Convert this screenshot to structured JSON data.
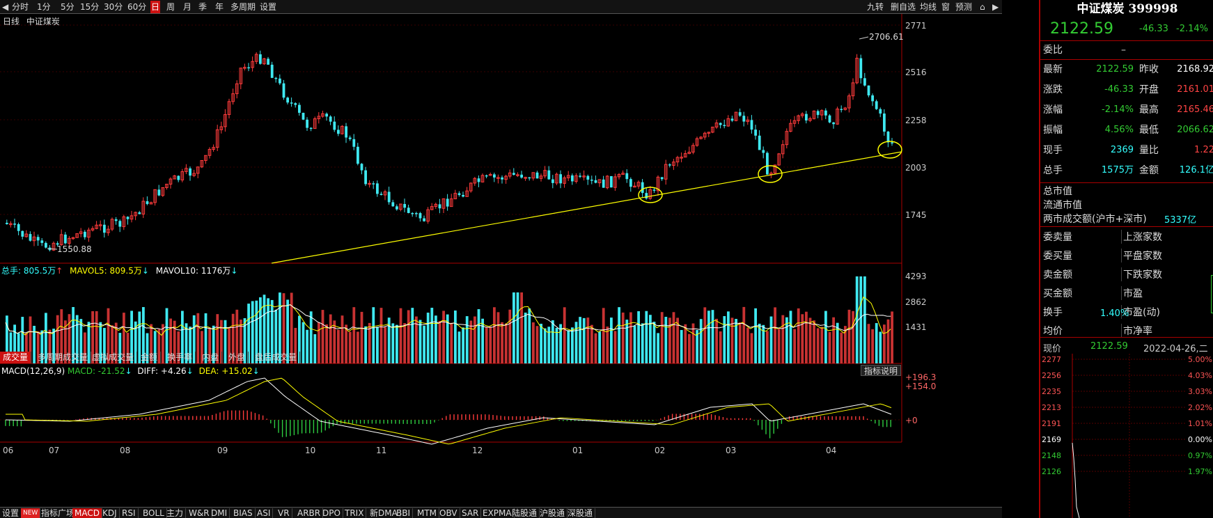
{
  "toolbar": {
    "items": [
      "分时",
      "1分",
      "5分",
      "15分",
      "30分",
      "60分",
      "日",
      "周",
      "月",
      "季",
      "年",
      "多周期",
      "设置"
    ],
    "active": "日",
    "right": [
      "九转",
      "删自选",
      "均线",
      "窗",
      "预测"
    ]
  },
  "chart": {
    "period_label": "日线",
    "name": "中证煤炭",
    "price_axis": [
      "2771",
      "2516",
      "2258",
      "2003",
      "1745"
    ],
    "high_label": "2706.61",
    "low_label": "1550.88"
  },
  "volume": {
    "total_label": "总手: 805.5万",
    "mavol5_label": "MAVOL5: 809.5万",
    "mavol10_label": "MAVOL10: 1176万",
    "axis": [
      "4293",
      "2862",
      "1431"
    ]
  },
  "volume_tabs": [
    "成交量",
    "多周期成交量",
    "虚拟成交量",
    "金额",
    "换手率",
    "内盘",
    "外盘",
    "盘后成交量"
  ],
  "macd": {
    "title": "MACD(12,26,9)",
    "macd_label": "MACD: -21.52",
    "diff_label": "DIFF: +4.26",
    "dea_label": "DEA: +15.02",
    "axis": [
      "+196.3",
      "+154.0",
      "+0"
    ],
    "explain": "指标说明"
  },
  "months": [
    "06",
    "07",
    "08",
    "09",
    "10",
    "11",
    "12",
    "01",
    "02",
    "03",
    "04"
  ],
  "bottom_tabs": [
    "设置",
    "NEW",
    "指标广场",
    "MACD",
    "KDJ",
    "RSI",
    "BOLL",
    "主力",
    "W&R",
    "DMI",
    "BIAS",
    "ASI",
    "VR",
    "ARBR",
    "DPO",
    "TRIX",
    "新DMA",
    "BBI",
    "MTM",
    "OBV",
    "SAR",
    "EXPMA",
    "陆股通",
    "沪股通",
    "深股通"
  ],
  "quote": {
    "title": "中证煤炭 399998",
    "price": "2122.59",
    "change": "-46.33",
    "pct": "-2.14%",
    "weibi": "委比",
    "weibi_v": "–",
    "rows": [
      [
        "最新",
        "2122.59",
        "昨收",
        "2168.92"
      ],
      [
        "涨跌",
        "-46.33",
        "开盘",
        "2161.01"
      ],
      [
        "涨幅",
        "-2.14%",
        "最高",
        "2165.46"
      ],
      [
        "振幅",
        "4.56%",
        "最低",
        "2066.62"
      ],
      [
        "现手",
        "2369",
        "量比",
        "1.22"
      ],
      [
        "总手",
        "1575万",
        "金额",
        "126.1亿"
      ]
    ],
    "rows2": [
      "总市值",
      "流通市值",
      "两市成交额(沪市+深市)"
    ],
    "turnover_total": "5337亿",
    "rows3": [
      [
        "委卖量",
        "上涨家数"
      ],
      [
        "委买量",
        "平盘家数"
      ],
      [
        "卖金额",
        "下跌家数"
      ],
      [
        "买金额",
        "市盈"
      ],
      [
        "换手",
        "市盈(动)"
      ],
      [
        "均价",
        "市净率"
      ]
    ],
    "turnover_rate": "1.40%",
    "intraday_label": "现价",
    "intraday_price": "2122.59",
    "date": "2022-04-26,二",
    "mini_axis": [
      "2277",
      "2256",
      "2235",
      "2213",
      "2191",
      "2169",
      "2148",
      "2126"
    ],
    "mini_pct": [
      "5.00%",
      "4.03%",
      "3.03%",
      "2.02%",
      "1.01%",
      "0.00%",
      "0.97%",
      "1.97%"
    ]
  },
  "colors": {
    "up": "#ff3b3b",
    "down": "#3fe8f0",
    "trendline": "#ffff00",
    "mavol5": "#ffff00",
    "mavol10": "#ffffff"
  }
}
